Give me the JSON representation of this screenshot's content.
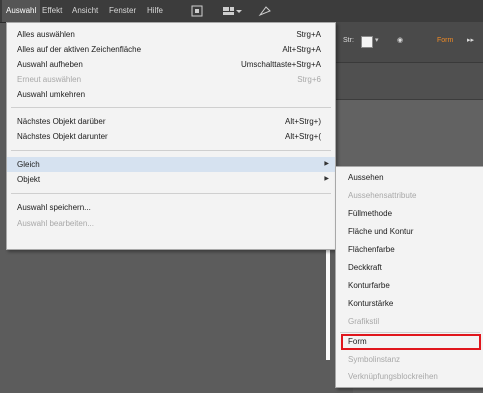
{
  "menubar": {
    "items": [
      "Auswahl",
      "Effekt",
      "Ansicht",
      "Fenster",
      "Hilfe"
    ],
    "icons": [
      "bridge-icon",
      "arrange-documents-icon",
      "gpu-icon"
    ]
  },
  "toolbar": {
    "stroke_label": "Str:",
    "orange_label": "Form",
    "dropdown_glyph": "▾"
  },
  "menu": {
    "items": [
      {
        "label": "Alles auswählen",
        "shortcut": "Strg+A",
        "disabled": false
      },
      {
        "label": "Alles auf der aktiven Zeichenfläche",
        "shortcut": "Alt+Strg+A",
        "disabled": false
      },
      {
        "label": "Auswahl aufheben",
        "shortcut": "Umschalttaste+Strg+A",
        "disabled": false
      },
      {
        "label": "Erneut auswählen",
        "shortcut": "Strg+6",
        "disabled": true
      },
      {
        "label": "Auswahl umkehren",
        "shortcut": "",
        "disabled": false
      },
      {
        "label": "Nächstes Objekt darüber",
        "shortcut": "Alt+Strg+)",
        "disabled": false
      },
      {
        "label": "Nächstes Objekt darunter",
        "shortcut": "Alt+Strg+(",
        "disabled": false
      },
      {
        "label": "Gleich",
        "shortcut": "",
        "disabled": false,
        "submenu": true,
        "highlighted": true
      },
      {
        "label": "Objekt",
        "shortcut": "",
        "disabled": false,
        "submenu": true
      },
      {
        "label": "Auswahl speichern...",
        "shortcut": "",
        "disabled": false
      },
      {
        "label": "Auswahl bearbeiten...",
        "shortcut": "",
        "disabled": true
      }
    ],
    "arrow": "▶"
  },
  "submenu": {
    "items": [
      {
        "label": "Aussehen",
        "disabled": false
      },
      {
        "label": "Aussehensattribute",
        "disabled": true
      },
      {
        "label": "Füllmethode",
        "disabled": false
      },
      {
        "label": "Fläche und Kontur",
        "disabled": false
      },
      {
        "label": "Flächenfarbe",
        "disabled": false
      },
      {
        "label": "Deckkraft",
        "disabled": false
      },
      {
        "label": "Konturfarbe",
        "disabled": false
      },
      {
        "label": "Konturstärke",
        "disabled": false
      },
      {
        "label": "Grafikstil",
        "disabled": true
      },
      {
        "label": "Form",
        "disabled": false,
        "outlined": true
      },
      {
        "label": "Symbolinstanz",
        "disabled": true
      },
      {
        "label": "Verknüpfungsblockreihen",
        "disabled": true
      }
    ],
    "outline_color": "#e0161c"
  },
  "colors": {
    "menubar_bg": "#3c3c3c",
    "menu_bg": "#f3f3f3",
    "highlight": "#d6e2f0",
    "accent_orange": "#f08a24"
  }
}
